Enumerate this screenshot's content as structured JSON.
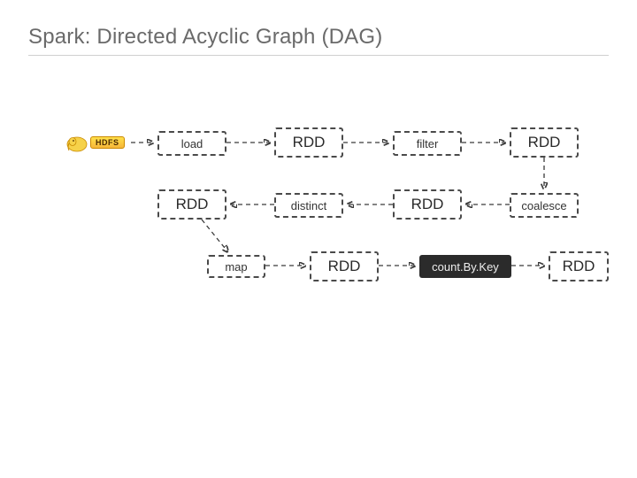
{
  "title": "Spark: Directed Acyclic Graph (DAG)",
  "hdfs_label": "HDFS",
  "nodes": {
    "load": "load",
    "rdd1": "RDD",
    "filter": "filter",
    "rdd2": "RDD",
    "rdd3": "RDD",
    "distinct": "distinct",
    "rdd4": "RDD",
    "coalesce": "coalesce",
    "map": "map",
    "rdd5": "RDD",
    "countbykey": "count.By.Key",
    "rdd6": "RDD"
  }
}
